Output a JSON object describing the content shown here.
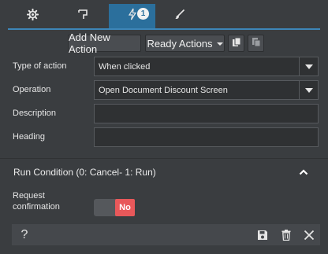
{
  "tabs": [
    {
      "icon": "gear-icon",
      "active": false
    },
    {
      "icon": "flag-icon",
      "active": false
    },
    {
      "icon": "lightning-icon",
      "active": true,
      "badge": "1"
    },
    {
      "icon": "brush-icon",
      "active": false
    }
  ],
  "toolbar": {
    "add_new_action": "Add New Action",
    "ready_actions": "Ready Actions",
    "copy_icon": "copy-icon",
    "paste_icon": "paste-icon"
  },
  "form": {
    "type_of_action": {
      "label": "Type of action",
      "value": "When clicked"
    },
    "operation": {
      "label": "Operation",
      "value": "Open Document Discount Screen"
    },
    "description": {
      "label": "Description",
      "value": ""
    },
    "heading": {
      "label": "Heading",
      "value": ""
    }
  },
  "run_condition": {
    "title": "Run Condition (0: Cancel- 1: Run)",
    "collapse_icon": "chevron-up-icon",
    "request_confirmation_label_line1": "Request",
    "request_confirmation_label_line2": "confirmation",
    "toggle_value": "No"
  },
  "footer": {
    "help": "?",
    "icons": [
      "save-icon",
      "trash-icon",
      "close-icon"
    ]
  },
  "colors": {
    "background": "#3a3d40",
    "accent": "#2b6f9c",
    "toggle_off": "#e8585a"
  }
}
